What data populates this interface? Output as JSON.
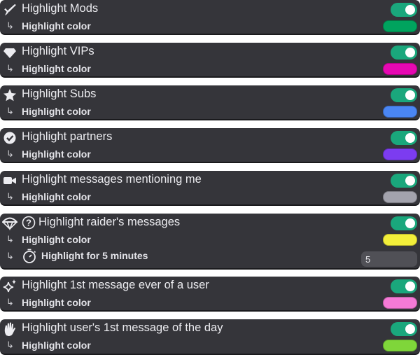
{
  "settings": [
    {
      "title": "Highlight Mods",
      "icon": "sword-icon",
      "enabled": true,
      "sub_label": "Highlight color",
      "color": "#00a35e"
    },
    {
      "title": "Highlight VIPs",
      "icon": "diamond-icon",
      "enabled": true,
      "sub_label": "Highlight color",
      "color": "#e608b2"
    },
    {
      "title": "Highlight Subs",
      "icon": "star-icon",
      "enabled": true,
      "sub_label": "Highlight color",
      "color": "#4a86f3"
    },
    {
      "title": "Highlight partners",
      "icon": "verified-badge-icon",
      "enabled": true,
      "sub_label": "Highlight color",
      "color": "#7c3cf0"
    },
    {
      "title": "Highlight messages mentioning me",
      "icon": "camera-icon",
      "enabled": true,
      "sub_label": "Highlight color",
      "color": "#a3a3ad"
    },
    {
      "title": "Highlight raider's messages",
      "icon": "parachute-icon",
      "enabled": true,
      "sub_label": "Highlight color",
      "color": "#f2ee3a",
      "duration_label": "Highlight for 5 minutes",
      "duration_value": "5"
    },
    {
      "title": "Highlight 1st message ever of a user",
      "icon": "sparkle-icon",
      "enabled": true,
      "sub_label": "Highlight color",
      "color": "#f57ad6"
    },
    {
      "title": "Highlight user's 1st message of the day",
      "icon": "hand-wave-icon",
      "enabled": true,
      "sub_label": "Highlight color",
      "color": "#7fd63a"
    }
  ],
  "sub_arrow": "↳"
}
